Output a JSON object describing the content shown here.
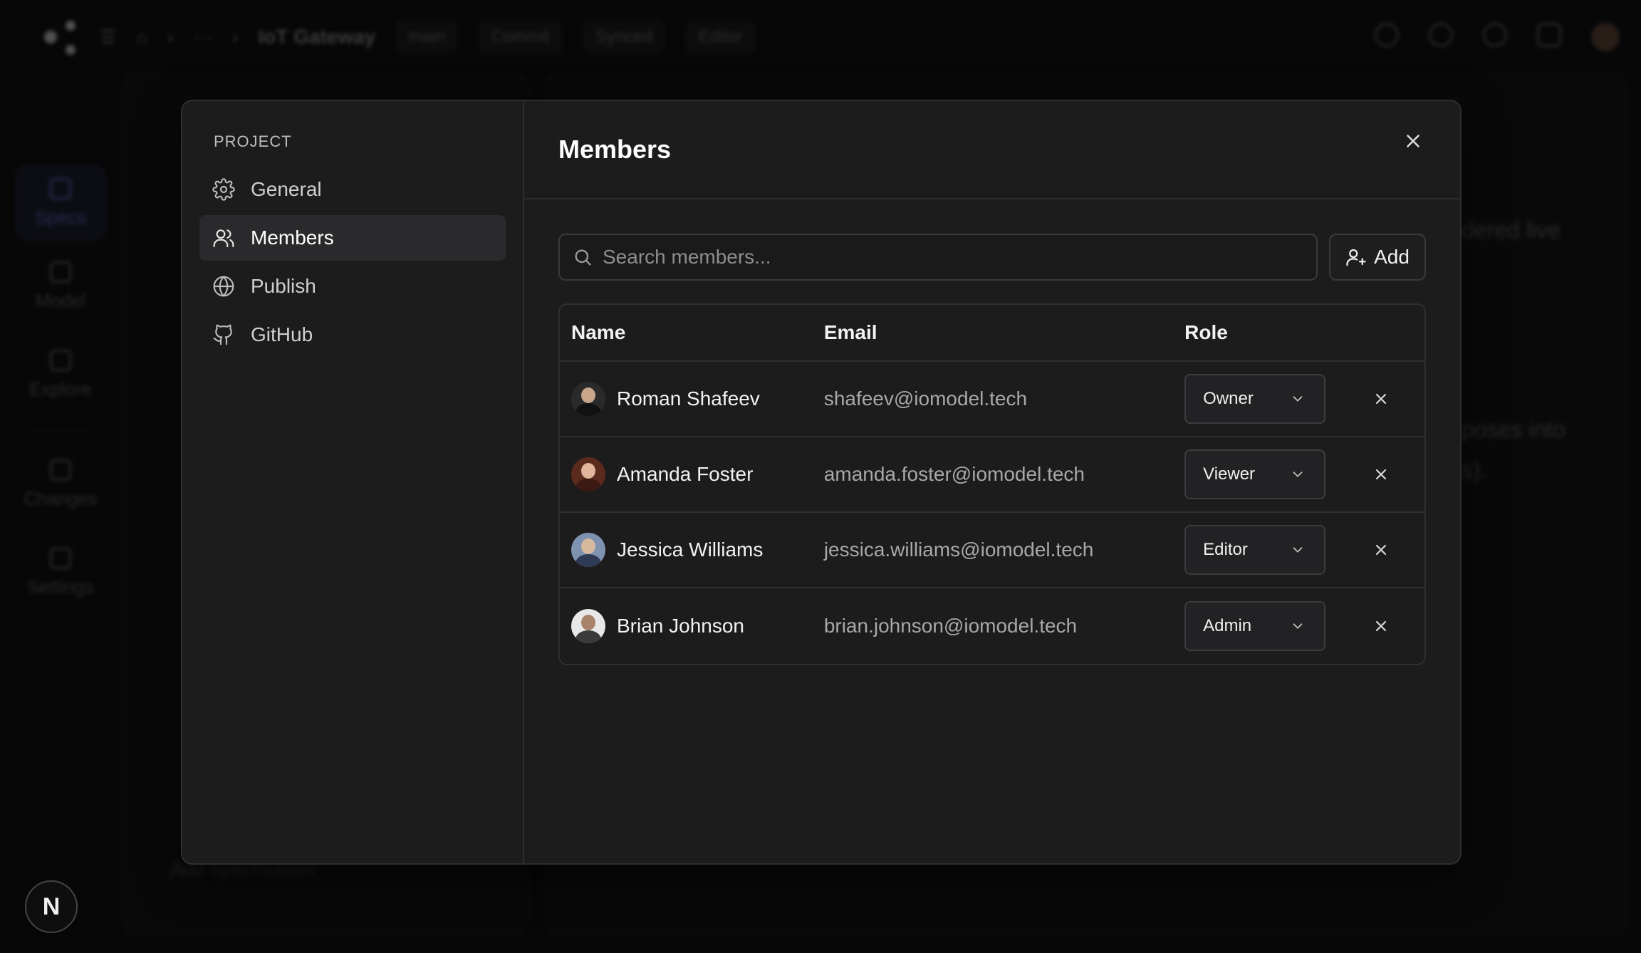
{
  "background": {
    "breadcrumb_title": "IoT Gateway",
    "branch": "main",
    "commit_label": "Commit",
    "synced_label": "Synced",
    "editor_label": "Editor",
    "rail": [
      {
        "label": "Specs",
        "icon": "specs-icon"
      },
      {
        "label": "Model",
        "icon": "model-icon"
      },
      {
        "label": "Explore",
        "icon": "explore-icon"
      },
      {
        "label": "Changes",
        "icon": "changes-icon"
      },
      {
        "label": "Settings",
        "icon": "settings-icon"
      }
    ],
    "add_specification": "Add Specification",
    "peek_text_1": "dered live",
    "peek_text_2": "poses into",
    "peek_text_3": "s).",
    "nextjs_badge": "N"
  },
  "modal": {
    "sidebar": {
      "heading": "PROJECT",
      "items": [
        {
          "label": "General",
          "icon": "gear-icon",
          "active": false
        },
        {
          "label": "Members",
          "icon": "users-icon",
          "active": true
        },
        {
          "label": "Publish",
          "icon": "globe-icon",
          "active": false
        },
        {
          "label": "GitHub",
          "icon": "github-icon",
          "active": false
        }
      ]
    },
    "title": "Members",
    "search": {
      "placeholder": "Search members...",
      "value": ""
    },
    "add_label": "Add",
    "table": {
      "headers": {
        "name": "Name",
        "email": "Email",
        "role": "Role"
      },
      "rows": [
        {
          "name": "Roman Shafeev",
          "email": "shafeev@iomodel.tech",
          "role": "Owner"
        },
        {
          "name": "Amanda Foster",
          "email": "amanda.foster@iomodel.tech",
          "role": "Viewer"
        },
        {
          "name": "Jessica Williams",
          "email": "jessica.williams@iomodel.tech",
          "role": "Editor"
        },
        {
          "name": "Brian Johnson",
          "email": "brian.johnson@iomodel.tech",
          "role": "Admin"
        }
      ]
    }
  },
  "colors": {
    "accent": "#6170d8",
    "modal_bg": "#1c1c1d",
    "border": "#2f2f31"
  }
}
